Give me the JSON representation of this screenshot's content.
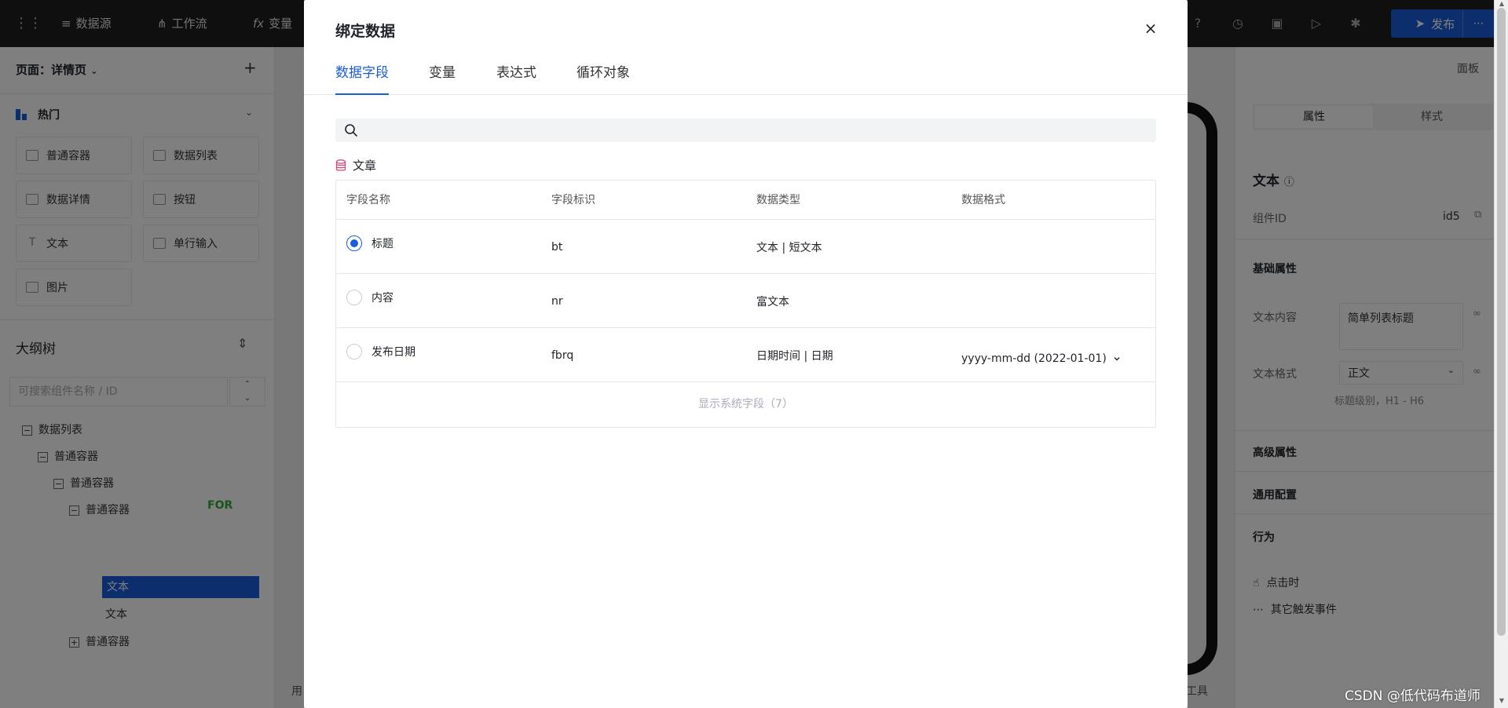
{
  "topbar": {
    "nav": [
      {
        "label": "数据源",
        "icon": "database-icon"
      },
      {
        "label": "工作流",
        "icon": "workflow-icon"
      },
      {
        "label": "变量",
        "icon": "fx-icon"
      }
    ],
    "publish_label": "发布"
  },
  "left_panel": {
    "page_select": "页面：详情页",
    "hot_title": "热门",
    "components": [
      "普通容器",
      "数据列表",
      "数据详情",
      "按钮",
      "文本",
      "单行输入",
      "图片"
    ],
    "outline_title": "大纲树",
    "outline_search_placeholder": "可搜索组件名称 / ID",
    "tree": [
      {
        "label": "数据列表",
        "level": 0
      },
      {
        "label": "普通容器",
        "level": 1
      },
      {
        "label": "普通容器",
        "level": 2
      },
      {
        "label": "普通容器",
        "level": 3
      },
      {
        "label": "文本",
        "level": 4,
        "selected": true
      },
      {
        "label": "文本",
        "level": 4
      },
      {
        "label": "普通容器",
        "level": 3
      }
    ],
    "for_tag": "FOR"
  },
  "canvas": {
    "panel_label": "面板",
    "bottom_left": "用",
    "bottom_right": "工具"
  },
  "right_panel": {
    "tabs": [
      "属性",
      "样式"
    ],
    "component_title": "文本",
    "component_id_label": "组件ID",
    "component_id_value": "id5",
    "section_basic": "基础属性",
    "text_content_label": "文本内容",
    "text_content_value": "简单列表标题",
    "text_format_label": "文本格式",
    "text_format_value": "正文",
    "text_format_hint": "标题级别，H1 - H6",
    "section_advanced": "高级属性",
    "section_general": "通用配置",
    "section_behavior": "行为",
    "on_click": "点击时",
    "other_events": "其它触发事件"
  },
  "modal": {
    "title": "绑定数据",
    "tabs": [
      "数据字段",
      "变量",
      "表达式",
      "循环对象"
    ],
    "active_tab": "数据字段",
    "search_placeholder": "",
    "entity": "文章",
    "columns": [
      "字段名称",
      "字段标识",
      "数据类型",
      "数据格式"
    ],
    "rows": [
      {
        "name": "标题",
        "key": "bt",
        "type": "文本 | 短文本",
        "format": "",
        "checked": true
      },
      {
        "name": "内容",
        "key": "nr",
        "type": "富文本",
        "format": "",
        "checked": false
      },
      {
        "name": "发布日期",
        "key": "fbrq",
        "type": "日期时间 | 日期",
        "format": "yyyy-mm-dd (2022-01-01)",
        "checked": false
      }
    ],
    "show_system_fields": "显示系统字段（7）"
  },
  "watermark": "CSDN @低代码布道师",
  "colors": {
    "accent": "#1a5cd9",
    "topbar": "#1f1f1f",
    "for_tag": "#2eaa3a"
  }
}
